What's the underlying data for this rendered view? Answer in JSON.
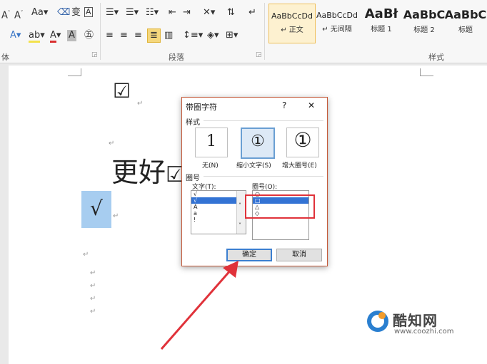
{
  "ribbon": {
    "font_group_label": "体",
    "paragraph_group_label": "段落",
    "styles_group_label": "样式",
    "styles": [
      {
        "sample": "AaBbCcDd",
        "name": "↵ 正文"
      },
      {
        "sample": "AaBbCcDd",
        "name": "↵ 无间隔"
      },
      {
        "sample": "AaBł",
        "name": "标题 1"
      },
      {
        "sample": "AaBbC",
        "name": "标题 2"
      },
      {
        "sample": "AaBbC",
        "name": "标题"
      }
    ]
  },
  "document": {
    "checkbox_symbol": "☑",
    "text_line": "更好",
    "text_trailing_symbol": "☑",
    "check_mark": "√",
    "para_mark": "↵"
  },
  "dialog": {
    "title": "带圈字符",
    "help": "?",
    "close": "✕",
    "style_section": "样式",
    "options": [
      {
        "glyph": "1",
        "label": "无(N)"
      },
      {
        "glyph": "①",
        "label": "缩小文字(S)"
      },
      {
        "glyph": "①",
        "label": "增大圈号(E)"
      }
    ],
    "enclosure_section": "圈号",
    "text_label": "文字(T):",
    "text_list": [
      "√",
      "√",
      "A",
      "a",
      "!"
    ],
    "enclosure_label": "圈号(O):",
    "enclosure_list": [
      "○",
      "□",
      "△",
      "◇"
    ],
    "ok": "确定",
    "cancel": "取消"
  },
  "watermark": {
    "name": "酷知网",
    "url": "www.coozhi.com"
  },
  "colors": {
    "highlight_box": "#e0323a",
    "arrow": "#e0323a",
    "selection": "#3373d4",
    "check_highlight": "#a7cdf0"
  }
}
